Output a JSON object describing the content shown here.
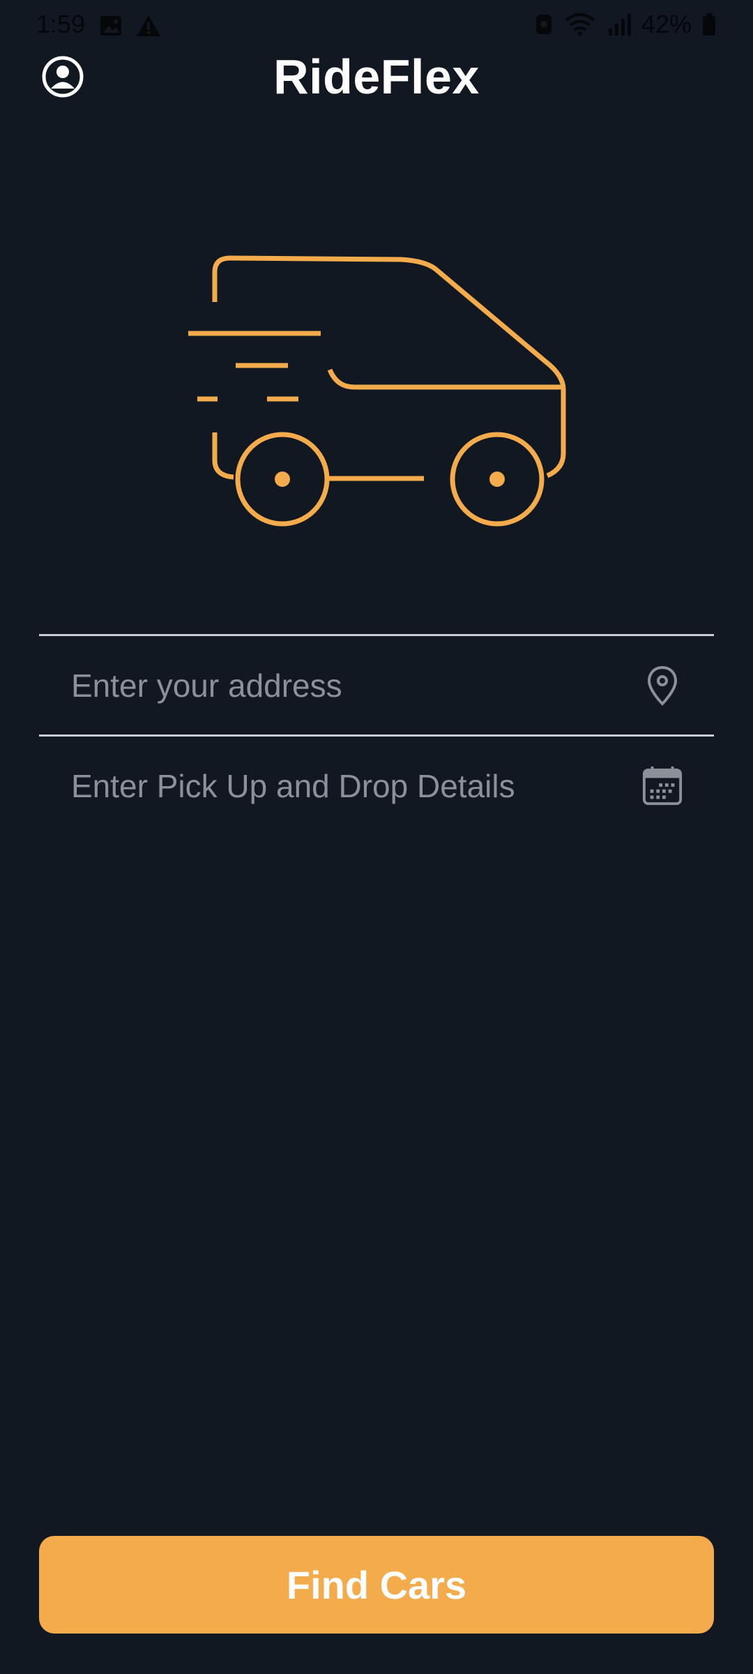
{
  "status_bar": {
    "time": "1:59",
    "battery": "42%",
    "icons": [
      "image-icon",
      "alert-icon",
      "alarm-icon",
      "wifi-icon",
      "signal-icon",
      "battery-icon"
    ]
  },
  "header": {
    "title": "RideFlex",
    "profile_icon": "account-circle-icon"
  },
  "hero": {
    "icon": "fast-car-illustration",
    "color": "#f4ab4c"
  },
  "form": {
    "address": {
      "placeholder": "Enter your address",
      "icon": "location-pin-icon"
    },
    "schedule": {
      "placeholder": "Enter Pick Up and Drop Details",
      "icon": "calendar-icon"
    }
  },
  "actions": {
    "find_cars_label": "Find Cars"
  },
  "colors": {
    "background": "#121821",
    "accent": "#f4ab4c",
    "divider": "#c9ced6",
    "placeholder": "#8c9198"
  }
}
